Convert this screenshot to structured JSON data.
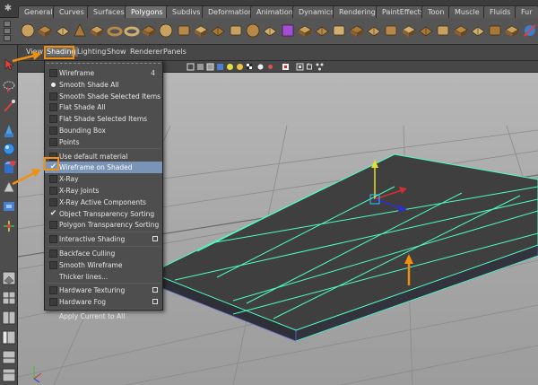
{
  "shelf": {
    "tabs": [
      "General",
      "Curves",
      "Surfaces",
      "Polygons",
      "Subdivs",
      "Deformation",
      "Animation",
      "Dynamics",
      "Rendering",
      "PaintEffects",
      "Toon",
      "Muscle",
      "Fluids",
      "Fur"
    ],
    "active_tab": "Polygons",
    "icons": [
      "sphere-icon",
      "cube-icon",
      "cylinder-icon",
      "cone-icon",
      "plane-icon",
      "torus-icon",
      "pipe-icon",
      "helix-icon",
      "soccer-ball-icon",
      "platonic-icon",
      "combine-icon",
      "separate-icon",
      "extract-icon",
      "smooth-icon",
      "boolean-icon",
      "mirror-icon",
      "extrude-icon",
      "bridge-icon",
      "append-icon",
      "split-icon",
      "insert-loop-icon",
      "offset-loop-icon",
      "merge-icon",
      "collapse-icon",
      "poke-icon",
      "wedge-icon",
      "duplicate-face-icon",
      "sculpt-icon",
      "planar-mapping-icon",
      "uv-editor-icon"
    ]
  },
  "viewport": {
    "menus": [
      "View",
      "Shading",
      "Lighting",
      "Show",
      "Renderer",
      "Panels"
    ],
    "open_menu": "Shading"
  },
  "shading_menu": {
    "items": [
      {
        "label": "Wireframe",
        "key": "4",
        "mark": "box"
      },
      {
        "label": "Smooth Shade All",
        "mark": "dot"
      },
      {
        "label": "Smooth Shade Selected Items",
        "mark": "box"
      },
      {
        "label": "Flat Shade All",
        "mark": "box"
      },
      {
        "label": "Flat Shade Selected Items",
        "mark": "box"
      },
      {
        "label": "Bounding Box",
        "mark": "box"
      },
      {
        "label": "Points",
        "mark": "box"
      },
      {
        "label": "Use default material",
        "mark": "box"
      },
      {
        "label": "Wireframe on Shaded",
        "mark": "check",
        "highlighted": true
      },
      {
        "label": "X-Ray",
        "mark": "box"
      },
      {
        "label": "X-Ray Joints",
        "mark": "box"
      },
      {
        "label": "X-Ray Active Components",
        "mark": "box"
      },
      {
        "label": "Object Transparency Sorting",
        "mark": "check"
      },
      {
        "label": "Polygon Transparency Sorting",
        "mark": "box"
      },
      {
        "label": "Interactive Shading",
        "mark": "box",
        "option_box": true
      },
      {
        "label": "Backface Culling",
        "mark": "box"
      },
      {
        "label": "Smooth Wireframe",
        "mark": "box"
      },
      {
        "label": "Thicker lines...",
        "mark": "none"
      },
      {
        "label": "Hardware Texturing",
        "mark": "box",
        "option_box": true
      },
      {
        "label": "Hardware Fog",
        "mark": "box",
        "option_box": true
      },
      {
        "label": "Apply Current to All",
        "mark": "none"
      }
    ]
  },
  "colors": {
    "annotation": "#f0900e",
    "wireframe": "#4dffc0",
    "selection_highlight": "#7a94b8",
    "plane_face": "#3d3d3d",
    "grid": "#8c8c8c"
  }
}
